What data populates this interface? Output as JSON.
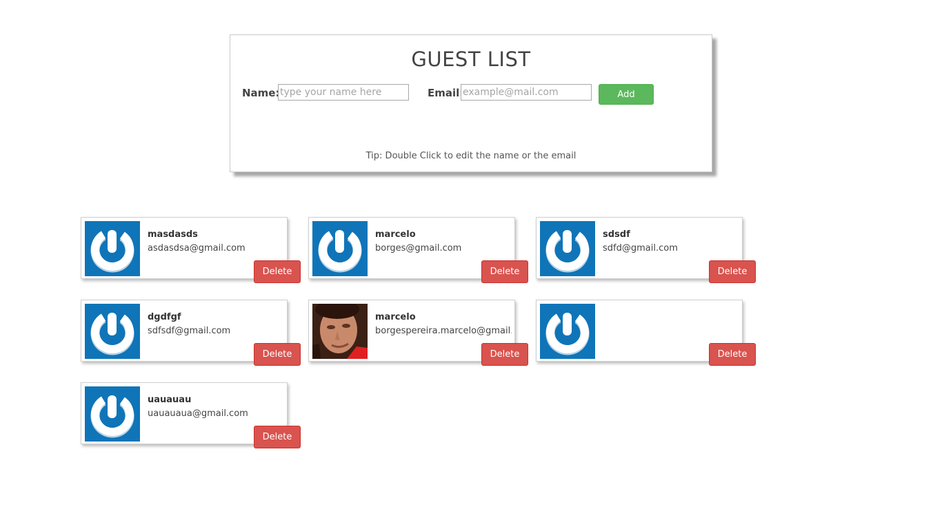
{
  "form": {
    "title": "GUEST LIST",
    "name_label": "Name:",
    "name_placeholder": "type your name here",
    "email_label": "Email:",
    "email_placeholder": "example@mail.com",
    "add_label": "Add",
    "tip": "Tip: Double Click to edit the name or the email"
  },
  "guests": [
    {
      "name": "masdasds",
      "email": "asdasdsa@gmail.com",
      "avatar": "gravatar-default-icon",
      "delete_label": "Delete"
    },
    {
      "name": "marcelo",
      "email": "borges@gmail.com",
      "avatar": "gravatar-default-icon",
      "delete_label": "Delete"
    },
    {
      "name": "sdsdf",
      "email": "sdfd@gmail.com",
      "avatar": "gravatar-default-icon",
      "delete_label": "Delete"
    },
    {
      "name": "dgdfgf",
      "email": "sdfsdf@gmail.com",
      "avatar": "gravatar-default-icon",
      "delete_label": "Delete"
    },
    {
      "name": "marcelo",
      "email": "borgespereira.marcelo@gmail.com",
      "avatar": "user-photo",
      "delete_label": "Delete"
    },
    {
      "name": "",
      "email": "",
      "avatar": "gravatar-default-icon",
      "delete_label": "Delete"
    },
    {
      "name": "uauauau",
      "email": "uauauaua@gmail.com",
      "avatar": "gravatar-default-icon",
      "delete_label": "Delete"
    }
  ],
  "colors": {
    "add_button": "#5cb85c",
    "delete_button": "#d9534f",
    "avatar_blue": "#0f75b8"
  }
}
